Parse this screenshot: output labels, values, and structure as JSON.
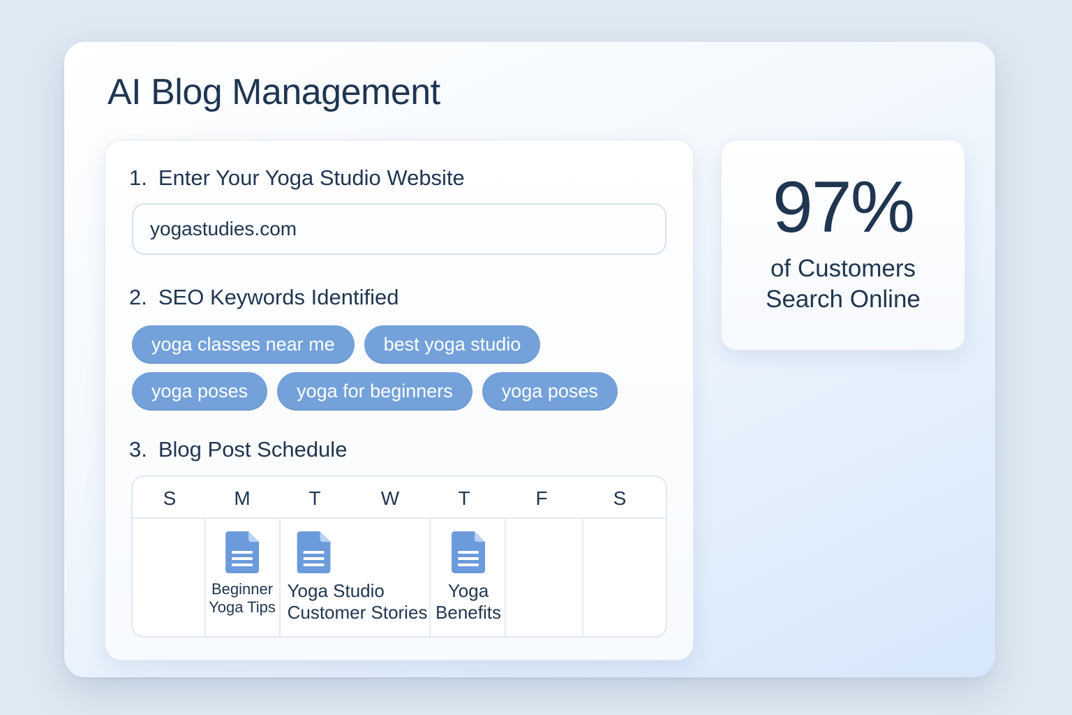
{
  "page": {
    "title": "AI Blog Management"
  },
  "steps": {
    "website": {
      "number": "1.",
      "label": "Enter Your Yoga Studio Website",
      "input_value": "yogastudies.com"
    },
    "keywords": {
      "number": "2.",
      "label": "SEO Keywords Identified",
      "items": [
        "yoga classes near me",
        "best yoga studio",
        "yoga poses",
        "yoga for beginners",
        "yoga poses"
      ]
    },
    "schedule": {
      "number": "3.",
      "label": "Blog Post Schedule",
      "days": [
        "S",
        "M",
        "T",
        "W",
        "T",
        "F",
        "S"
      ],
      "posts": [
        {
          "title": "Beginner\nYoga Tips"
        },
        {
          "title": "Yoga Studio\nCustomer Stories"
        },
        {
          "title": "Yoga\nBenefits"
        }
      ],
      "icon": "document-icon"
    }
  },
  "stat": {
    "value": "97%",
    "caption": "of Customers\nSearch Online"
  },
  "colors": {
    "accent": "#74a1da",
    "text": "#1f3550",
    "icon": "#6b9bdb"
  }
}
